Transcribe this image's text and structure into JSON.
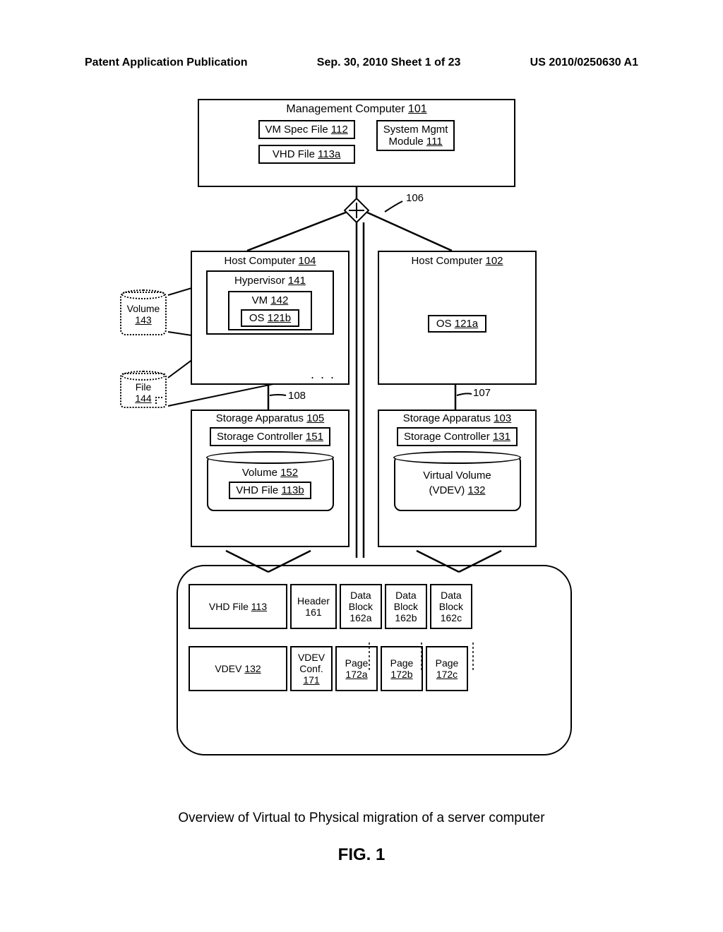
{
  "header": {
    "left": "Patent Application Publication",
    "mid": "Sep. 30, 2010  Sheet 1 of 23",
    "right": "US 2010/0250630 A1"
  },
  "mgmt": {
    "title": "Management Computer",
    "title_ref": "101",
    "vmspec": "VM Spec File",
    "vmspec_ref": "112",
    "vhdfile": "VHD File",
    "vhdfile_ref": "113a",
    "sysmgmt_l1": "System Mgmt",
    "sysmgmt_l2": "Module",
    "sysmgmt_ref": "111"
  },
  "netnode_ref": "106",
  "host104": {
    "title": "Host Computer",
    "ref": "104",
    "hyper": "Hypervisor",
    "hyper_ref": "141",
    "vm": "VM",
    "vm_ref": "142",
    "os": "OS",
    "os_ref": "121b"
  },
  "host102": {
    "title": "Host Computer",
    "ref": "102",
    "os": "OS",
    "os_ref": "121a"
  },
  "link108": "108",
  "link107": "107",
  "storage105": {
    "title": "Storage Apparatus",
    "ref": "105",
    "ctrl": "Storage Controller",
    "ctrl_ref": "151",
    "vol": "Volume",
    "vol_ref": "152",
    "vhd": "VHD File",
    "vhd_ref": "113b"
  },
  "storage103": {
    "title": "Storage Apparatus",
    "ref": "103",
    "ctrl": "Storage Controller",
    "ctrl_ref": "131",
    "vol_l1": "Virtual Volume",
    "vol_l2": "(VDEV)",
    "vol_ref": "132"
  },
  "leftcallouts": {
    "vol": "Volume",
    "vol_ref": "143",
    "file": "File",
    "file_ref": "144"
  },
  "callout": {
    "row1_wide": "VHD File",
    "row1_wide_ref": "113",
    "header_l1": "Header",
    "header_l2": "161",
    "db_l1": "Data",
    "db_l2": "Block",
    "db_a": "162a",
    "db_b": "162b",
    "db_c": "162c",
    "row2_wide": "VDEV",
    "row2_wide_ref": "132",
    "vconf_l1": "VDEV",
    "vconf_l2": "Conf.",
    "vconf_ref": "171",
    "page": "Page",
    "page_a": "172a",
    "page_b": "172b",
    "page_c": "172c"
  },
  "caption": "Overview of Virtual to Physical migration of a server computer",
  "fig": "FIG. 1"
}
